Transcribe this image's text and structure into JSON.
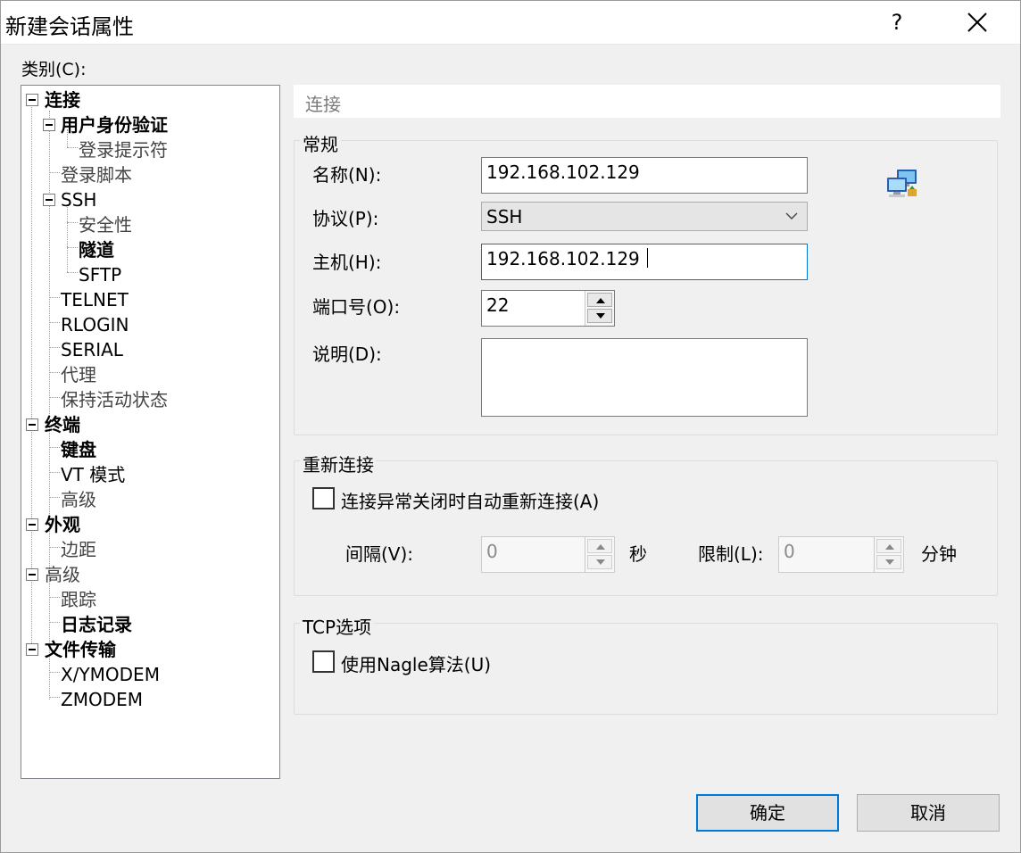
{
  "window": {
    "title": "新建会话属性",
    "help_label": "?",
    "close_icon": "close-icon"
  },
  "category_label": "类别(C):",
  "tree": {
    "connection": "连接",
    "user_auth": "用户身份验证",
    "login_prompt": "登录提示符",
    "login_script": "登录脚本",
    "ssh": "SSH",
    "security": "安全性",
    "tunnel": "隧道",
    "sftp": "SFTP",
    "telnet": "TELNET",
    "rlogin": "RLOGIN",
    "serial": "SERIAL",
    "proxy": "代理",
    "keepalive": "保持活动状态",
    "terminal": "终端",
    "keyboard": "键盘",
    "vt_mode": "VT 模式",
    "term_advanced": "高级",
    "appearance": "外观",
    "margin": "边距",
    "advanced": "高级",
    "trace": "跟踪",
    "logging": "日志记录",
    "file_transfer": "文件传输",
    "xymodem": "X/YMODEM",
    "zmodem": "ZMODEM"
  },
  "section_header": "连接",
  "general": {
    "title": "常规",
    "name_label": "名称(N):",
    "name_value": "192.168.102.129",
    "protocol_label": "协议(P):",
    "protocol_value": "SSH",
    "host_label": "主机(H):",
    "host_value": "192.168.102.129",
    "port_label": "端口号(O):",
    "port_value": "22",
    "desc_label": "说明(D):",
    "desc_value": ""
  },
  "reconnect": {
    "title": "重新连接",
    "auto_label": "连接异常关闭时自动重新连接(A)",
    "auto_checked": false,
    "interval_label": "间隔(V):",
    "interval_value": "0",
    "interval_unit": "秒",
    "limit_label": "限制(L):",
    "limit_value": "0",
    "limit_unit": "分钟"
  },
  "tcp": {
    "title": "TCP选项",
    "nagle_label": "使用Nagle算法(U)",
    "nagle_checked": false
  },
  "buttons": {
    "ok": "确定",
    "cancel": "取消"
  },
  "colors": {
    "accent": "#0078d7",
    "dialog_bg": "#f0f0f0"
  }
}
